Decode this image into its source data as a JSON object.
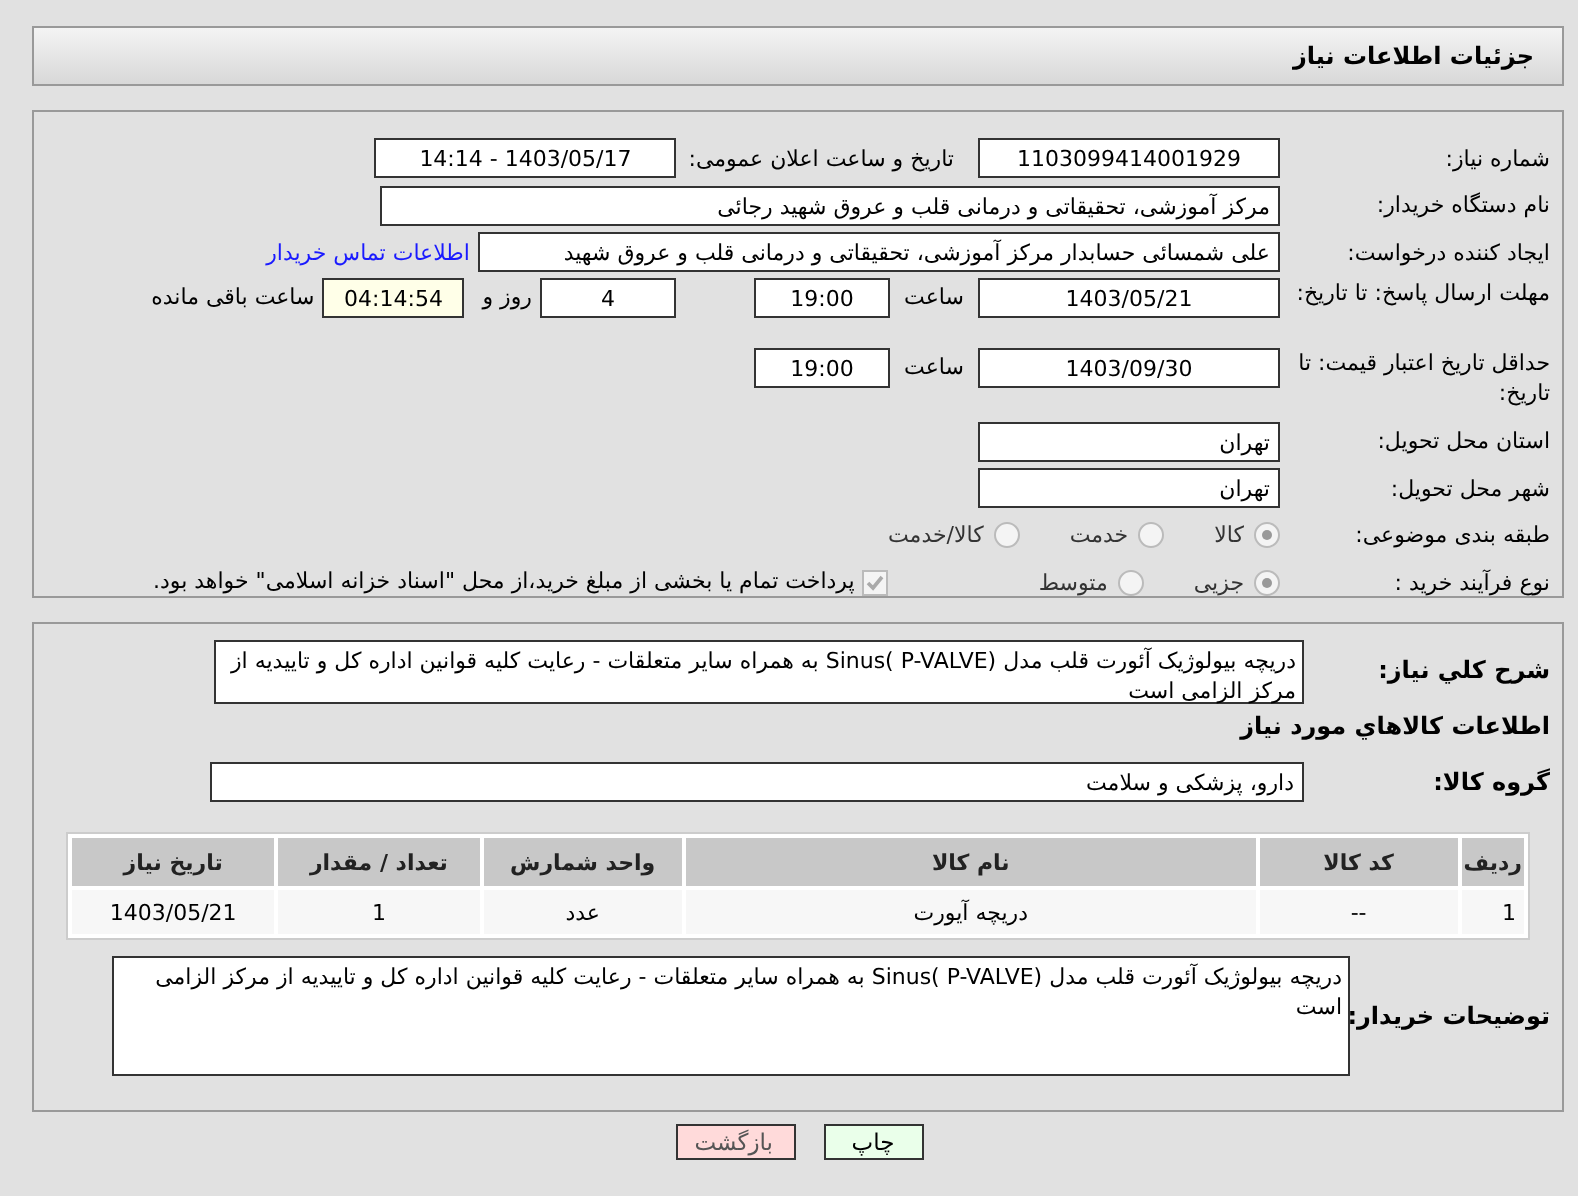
{
  "header": {
    "title": "جزئیات اطلاعات نیاز"
  },
  "need_number": {
    "label": "شماره نیاز:",
    "value": "1103099414001929"
  },
  "announce": {
    "label": "تاریخ و ساعت اعلان عمومی:",
    "value": "1403/05/17 - 14:14"
  },
  "buyer_org": {
    "label": "نام دستگاه خریدار:",
    "value": "مرکز آموزشی، تحقیقاتی و درمانی قلب و عروق شهید رجائی"
  },
  "requester": {
    "label": "ایجاد کننده درخواست:",
    "value": "علی شمسائی حسابدار مرکز آموزشی، تحقیقاتی و درمانی قلب و عروق شهید",
    "link": "اطلاعات تماس خریدار"
  },
  "reply_deadline": {
    "label": "مهلت ارسال پاسخ: تا تاریخ:",
    "date": "1403/05/21",
    "time_label": "ساعت",
    "time": "19:00",
    "days": "4",
    "days_label": "روز و",
    "remaining": "04:14:54",
    "remaining_label": "ساعت باقی مانده"
  },
  "price_validity": {
    "label": "حداقل تاریخ اعتبار قیمت: تا تاریخ:",
    "date": "1403/09/30",
    "time_label": "ساعت",
    "time": "19:00"
  },
  "province": {
    "label": "استان محل تحویل:",
    "value": "تهران"
  },
  "city": {
    "label": "شهر محل تحویل:",
    "value": "تهران"
  },
  "category": {
    "label": "طبقه بندی موضوعی:",
    "options": [
      {
        "label": "کالا",
        "selected": true
      },
      {
        "label": "خدمت",
        "selected": false
      },
      {
        "label": "کالا/خدمت",
        "selected": false
      }
    ]
  },
  "process": {
    "label": "نوع فرآیند خرید :",
    "options": [
      {
        "label": "جزیی",
        "selected": true
      },
      {
        "label": "متوسط",
        "selected": false
      }
    ],
    "payment": {
      "checked": true,
      "text": "پرداخت تمام یا بخشی از مبلغ خرید،از محل \"اسناد خزانه اسلامی\" خواهد بود."
    }
  },
  "summary": {
    "label": "شرح کلي نياز:",
    "text": "دریچه بیولوژیک آئورت قلب مدل Sinus( P-VALVE) به همراه سایر متعلقات - رعایت کلیه قوانین اداره کل و تاییدیه از مرکز الزامی است"
  },
  "goods": {
    "title": "اطلاعات کالاهاي مورد نياز",
    "group": {
      "label": "گروه کالا:",
      "value": "دارو، پزشکی و سلامت"
    },
    "table": {
      "columns": [
        "ردیف",
        "کد کالا",
        "نام کالا",
        "واحد شمارش",
        "تعداد / مقدار",
        "تاریخ نیاز"
      ],
      "rows": [
        [
          "1",
          "--",
          "دریچه آیورت",
          "عدد",
          "1",
          "1403/05/21"
        ]
      ]
    }
  },
  "buyer_notes": {
    "label": "توضیحات خریدار:",
    "text": "دریچه بیولوژیک آئورت قلب مدل Sinus( P-VALVE) به همراه سایر متعلقات - رعایت کلیه قوانین اداره کل و تاییدیه از مرکز الزامی است"
  },
  "buttons": [
    {
      "label": "چاپ",
      "kind": "print"
    },
    {
      "label": "بازگشت",
      "kind": "back"
    }
  ]
}
